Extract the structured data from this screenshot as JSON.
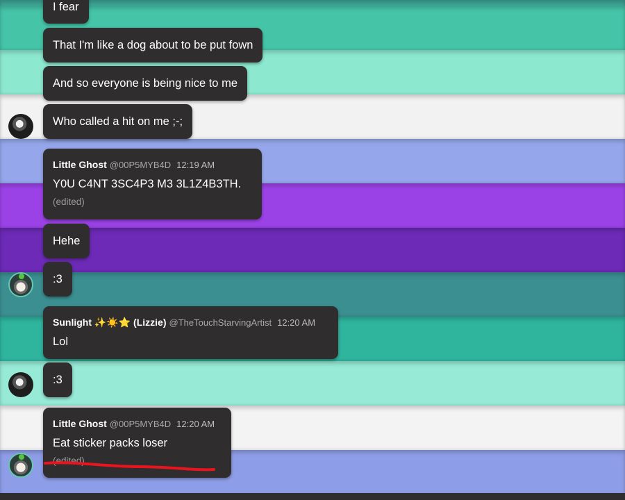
{
  "theme": {
    "bubble_bg": "#2f2d2d",
    "annotation_color": "#e8141e",
    "stripe_colors": [
      "#3ea597",
      "#45c4a8",
      "#8ce8cf",
      "#f2f2f2",
      "#95a7ea",
      "#9b42e6",
      "#6c2ab6",
      "#3b8f91",
      "#2fb49e",
      "#96ead6",
      "#f3f3f3",
      "#8e9de7"
    ]
  },
  "messages": [
    {
      "text": "I fear"
    },
    {
      "text": "That I'm like a dog about to be put fown"
    },
    {
      "text": "And so everyone is being nice to me"
    },
    {
      "text": "Who called a hit on me ;-;"
    },
    {
      "author": "Little Ghost",
      "handle": "@00P5MYB4D",
      "time": "12:19 AM",
      "text": "Y0U C4NT 3SC4P3 M3 3L1Z4B3TH.",
      "edited": "(edited)"
    },
    {
      "text": "Hehe"
    },
    {
      "text": ":3"
    },
    {
      "author": "Sunlight ✨☀️⭐ (Lizzie)",
      "handle": "@TheTouchStarvingArtist",
      "time": "12:20 AM",
      "text": "Lol"
    },
    {
      "text": ":3"
    },
    {
      "author": "Little Ghost",
      "handle": "@00P5MYB4D",
      "time": "12:20 AM",
      "text": "Eat sticker packs loser",
      "edited": "(edited)"
    }
  ],
  "avatars": [
    {
      "user": "Sunlight",
      "icon": "user-avatar-icon"
    },
    {
      "user": "Little Ghost",
      "icon": "user-avatar-icon"
    },
    {
      "user": "Sunlight",
      "icon": "user-avatar-icon"
    },
    {
      "user": "Little Ghost",
      "icon": "user-avatar-icon"
    }
  ]
}
